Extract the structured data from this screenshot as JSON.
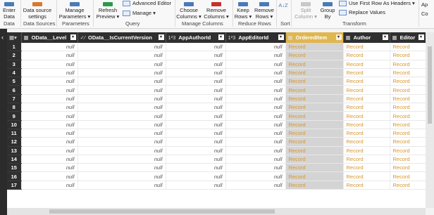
{
  "ribbon": {
    "buttons": [
      {
        "id": "enter-data",
        "label": "Enter\nData",
        "color": "#4a7ab8"
      },
      {
        "id": "data-source-settings",
        "label": "Data source\nsettings",
        "color": "#d8792f"
      },
      {
        "id": "manage-parameters",
        "label": "Manage\nParameters ▾",
        "color": "#4a7ab8"
      },
      {
        "id": "refresh-preview",
        "label": "Refresh\nPreview ▾",
        "color": "#2c9a4a"
      },
      {
        "id": "choose-columns",
        "label": "Choose\nColumns ▾",
        "color": "#4a7ab8"
      },
      {
        "id": "remove-columns",
        "label": "Remove\nColumns ▾",
        "color": "#c9302c"
      },
      {
        "id": "keep-rows",
        "label": "Keep\nRows ▾",
        "color": "#4a7ab8"
      },
      {
        "id": "remove-rows",
        "label": "Remove\nRows ▾",
        "color": "#4a7ab8"
      },
      {
        "id": "split-column",
        "label": "Split\nColumn ▾",
        "color": "#b8b8b8"
      },
      {
        "id": "group-by",
        "label": "Group\nBy",
        "color": "#4a7ab8"
      }
    ],
    "query_small": {
      "advanced_editor": "Advanced Editor",
      "manage": "Manage ▾"
    },
    "transform_small": {
      "use_first_row": "Use First Row As Headers ▾",
      "replace_values": "Replace Values"
    },
    "sort_icon": "A↓Z",
    "extra_right": "Ap",
    "extra_right2": "Co",
    "groups": {
      "data": "Data",
      "data_sources": "Data Sources",
      "parameters": "Parameters",
      "query": "Query",
      "manage_columns": "Manage Columns",
      "reduce_rows": "Reduce Rows",
      "sort": "Sort",
      "transform": "Transform"
    }
  },
  "grid": {
    "columns": [
      {
        "type_icon": "▦",
        "name": "OData__Level",
        "selected": false
      },
      {
        "type_icon": "✓⁄",
        "name": "OData__IsCurrentVersion",
        "selected": false
      },
      {
        "type_icon": "1²3",
        "name": "AppAuthorId",
        "selected": false
      },
      {
        "type_icon": "1²3",
        "name": "AppEditorId",
        "selected": false
      },
      {
        "type_icon": "▦",
        "name": "OrderedItem",
        "selected": true
      },
      {
        "type_icon": "▦",
        "name": "Author",
        "selected": false
      },
      {
        "type_icon": "▦",
        "name": "Editor",
        "selected": false
      }
    ],
    "null_text": "null",
    "record_text": "Record",
    "row_numbers": [
      "1",
      "2",
      "3",
      "4",
      "5",
      "6",
      "7",
      "8",
      "9",
      "10",
      "11",
      "12",
      "13",
      "14",
      "15",
      "16",
      "17"
    ]
  },
  "colors": {
    "record": "#d9962c",
    "selected_header": "#e0b74f",
    "selected_column": "#d4d4d4",
    "header_bg": "#2f2f2f"
  }
}
